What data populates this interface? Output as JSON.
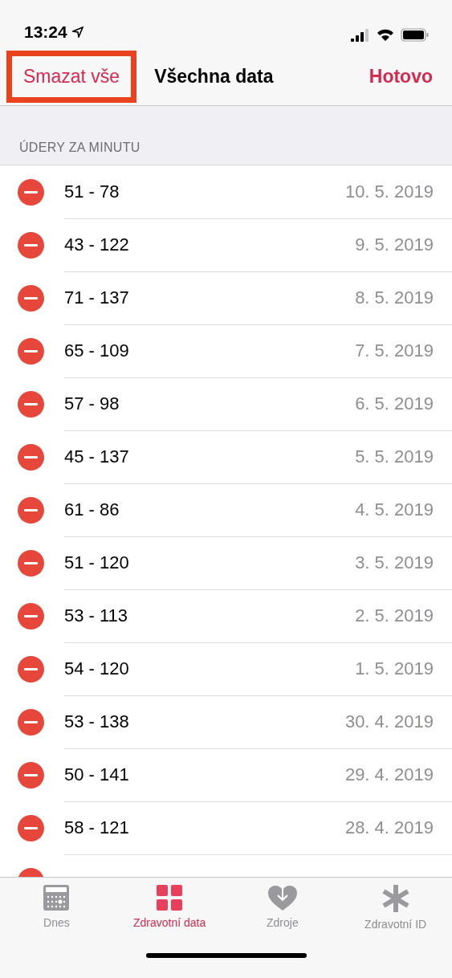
{
  "status_bar": {
    "time": "13:24"
  },
  "nav_bar": {
    "left_button": {
      "label": "Smazat vše",
      "highlighted": true
    },
    "title": "Všechna data",
    "right_button": {
      "label": "Hotovo"
    }
  },
  "section": {
    "header": "ÚDERY ZA MINUTU",
    "rows": [
      {
        "value": "51 - 78",
        "date": "10. 5. 2019"
      },
      {
        "value": "43 - 122",
        "date": "9. 5. 2019"
      },
      {
        "value": "71 - 137",
        "date": "8. 5. 2019"
      },
      {
        "value": "65 - 109",
        "date": "7. 5. 2019"
      },
      {
        "value": "57 - 98",
        "date": "6. 5. 2019"
      },
      {
        "value": "45 - 137",
        "date": "5. 5. 2019"
      },
      {
        "value": "61 - 86",
        "date": "4. 5. 2019"
      },
      {
        "value": "51 - 120",
        "date": "3. 5. 2019"
      },
      {
        "value": "53 - 113",
        "date": "2. 5. 2019"
      },
      {
        "value": "54 - 120",
        "date": "1. 5. 2019"
      },
      {
        "value": "53 - 138",
        "date": "30. 4. 2019"
      },
      {
        "value": "50 - 141",
        "date": "29. 4. 2019"
      },
      {
        "value": "58 - 121",
        "date": "28. 4. 2019"
      }
    ]
  },
  "tab_bar": [
    {
      "kind": "calendar",
      "label": "Dnes",
      "selected": false
    },
    {
      "kind": "grid",
      "label": "Zdravotní data",
      "selected": true
    },
    {
      "kind": "heart",
      "label": "Zdroje",
      "selected": false
    },
    {
      "kind": "asterisk",
      "label": "Zdravotní ID",
      "selected": false
    }
  ]
}
